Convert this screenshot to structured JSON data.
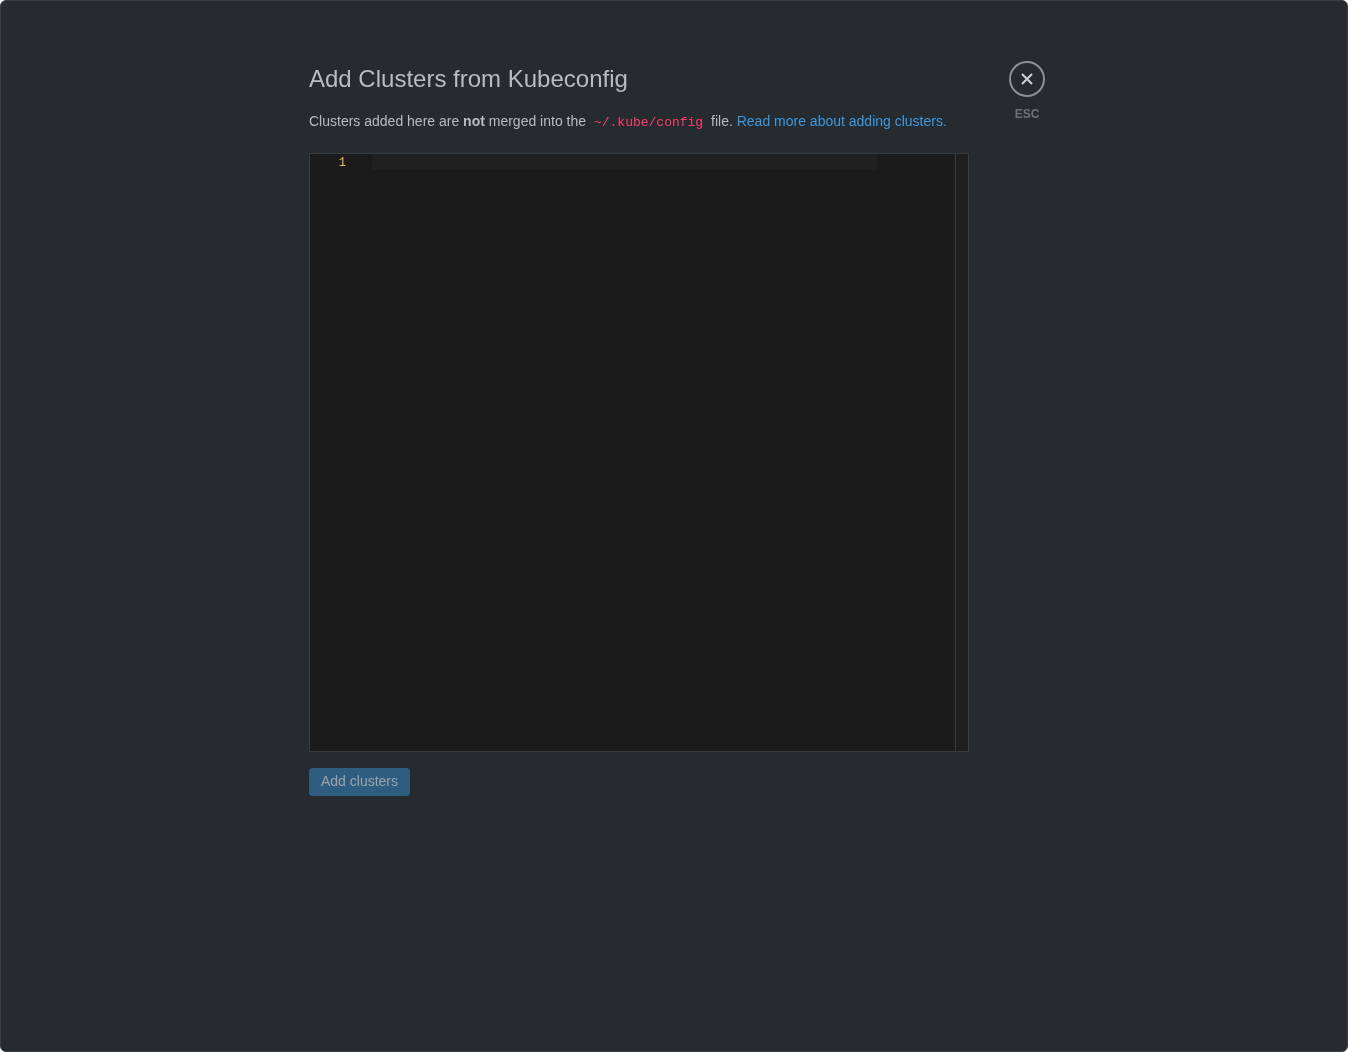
{
  "dialog": {
    "title": "Add Clusters from Kubeconfig",
    "description": {
      "before": "Clusters added here are **not** merged into the",
      "code": "~/.kube/config",
      "after": "file.",
      "link": "Read more about adding clusters."
    },
    "close": {
      "label": "ESC"
    },
    "editor": {
      "line_numbers": [
        "1"
      ]
    },
    "submit": {
      "label": "Add clusters",
      "disabled": true
    }
  }
}
